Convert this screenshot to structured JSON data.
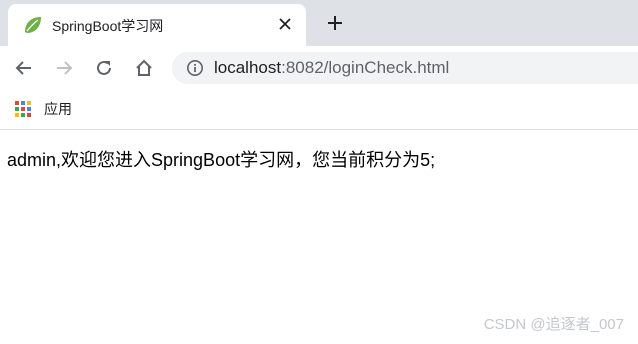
{
  "tab": {
    "title": "SpringBoot学习网",
    "favicon": "spring-leaf-icon",
    "close_icon": "close-icon"
  },
  "new_tab_icon": "plus-icon",
  "toolbar": {
    "back_icon": "arrow-left-icon",
    "forward_icon": "arrow-right-icon",
    "reload_icon": "reload-icon",
    "home_icon": "home-icon"
  },
  "address_bar": {
    "info_icon": "info-icon",
    "host": "localhost",
    "rest": ":8082/loginCheck.html"
  },
  "bookmarks": {
    "apps_label": "应用",
    "apps_icon": "apps-grid-icon"
  },
  "page": {
    "message": "admin,欢迎您进入SpringBoot学习网，您当前积分为5;"
  },
  "watermark": "CSDN @追逐者_007",
  "colors": {
    "tabstrip_bg": "#dee1e6",
    "omnibox_bg": "#f1f3f4",
    "spring_green": "#6db33f",
    "icon_gray": "#5f6368",
    "disabled_gray": "#bdc1c6"
  }
}
